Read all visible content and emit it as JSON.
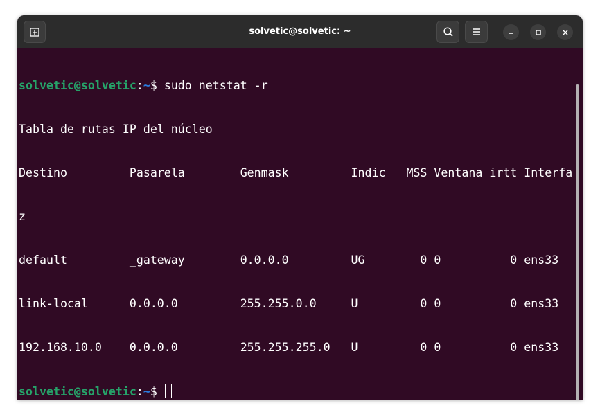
{
  "window": {
    "title": "solvetic@solvetic: ~"
  },
  "titlebar_icons": {
    "new_tab": "new-tab-icon",
    "search": "search-icon",
    "menu": "hamburger-menu-icon",
    "minimize": "minimize-icon",
    "maximize": "maximize-icon",
    "close": "close-icon"
  },
  "terminal": {
    "prompt_user": "solvetic@solvetic",
    "prompt_sep": ":",
    "prompt_path": "~",
    "prompt_symbol": "$ ",
    "command": "sudo netstat -r",
    "header_line": "Tabla de rutas IP del núcleo",
    "columns_line": "Destino         Pasarela        Genmask         Indic   MSS Ventana irtt Interfa",
    "columns_wrap": "z",
    "rows": [
      "default         _gateway        0.0.0.0         UG        0 0          0 ens33",
      "link-local      0.0.0.0         255.255.0.0     U         0 0          0 ens33",
      "192.168.10.0    0.0.0.0         255.255.255.0   U         0 0          0 ens33"
    ]
  },
  "colors": {
    "terminal_bg": "#300a24",
    "titlebar_bg": "#2c2c2c",
    "prompt_user": "#26a269",
    "prompt_path": "#2a7bde"
  }
}
